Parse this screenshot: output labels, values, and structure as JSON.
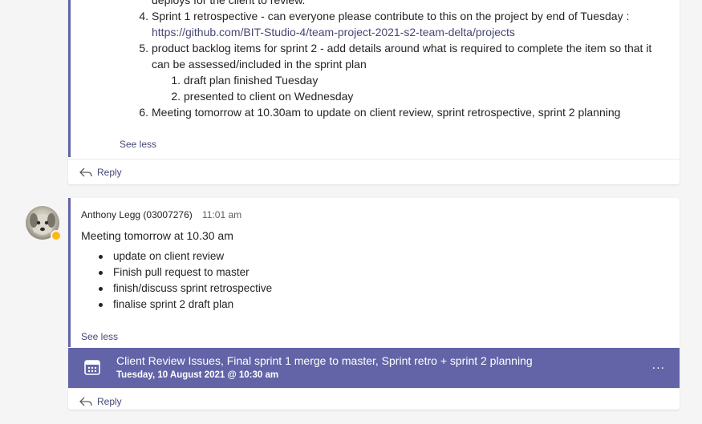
{
  "thread1": {
    "items": [
      {
        "number": "",
        "text": "deploys for the client to review."
      },
      {
        "number": "4.",
        "text": "Sprint 1 retrospective - can everyone please contribute to this on the project by end of Tuesday :"
      },
      {
        "number": "",
        "text": "https://github.com/BIT-Studio-4/team-project-2021-s2-team-delta/projects"
      },
      {
        "number": "5.",
        "text": "product backlog items for sprint 2 - add details around what is required to complete the item so that it"
      },
      {
        "number": "",
        "text": "can be assessed/included in the sprint plan"
      },
      {
        "number": "1.",
        "text": "draft plan finished Tuesday"
      },
      {
        "number": "2.",
        "text": "presented to client on Wednesday"
      },
      {
        "number": "6.",
        "text": "Meeting tomorrow at 10.30am to update on client review, sprint retrospective, sprint 2 planning"
      }
    ],
    "see_less": "See less",
    "reply": "Reply"
  },
  "thread2": {
    "author": "Anthony Legg (03007276)",
    "time": "11:01 am",
    "title": "Meeting tomorrow at 10.30 am",
    "bullets": [
      "update on client review",
      "Finish pull request to master",
      "finish/discuss sprint retrospective",
      "finalise sprint 2 draft plan"
    ],
    "see_less": "See less",
    "meeting": {
      "title": "Client Review Issues, Final sprint 1 merge to master, Sprint retro + sprint 2 planning",
      "date": "Tuesday, 10 August 2021 @ 10:30 am",
      "more": "..."
    },
    "reply": "Reply"
  },
  "colors": {
    "accent": "#6264a7",
    "link": "#464775",
    "presence": "#fdb913"
  },
  "icons": {
    "reply": "reply-arrow-icon",
    "calendar": "calendar-icon",
    "more": "more-options-icon",
    "presence": "away-status-icon"
  }
}
